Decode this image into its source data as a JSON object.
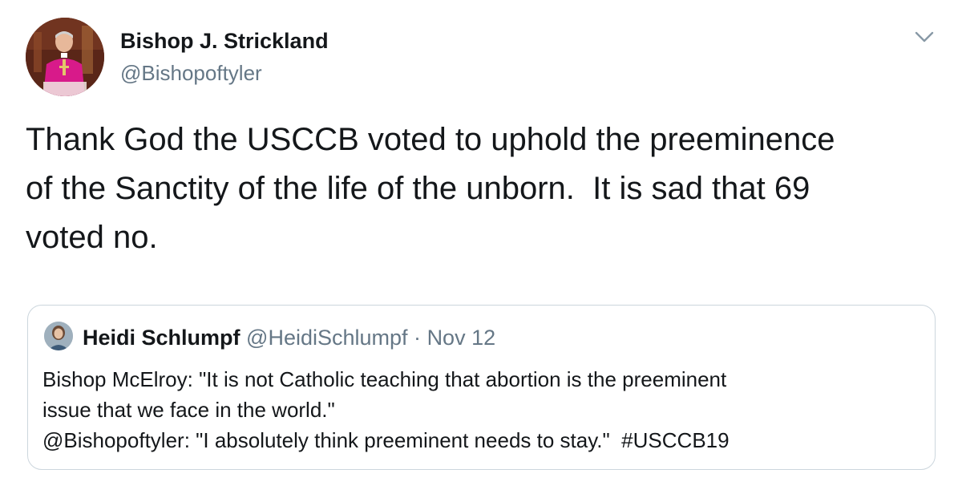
{
  "tweet": {
    "author": {
      "name": "Bishop J. Strickland",
      "handle": "@Bishopoftyler",
      "avatar_icon": "profile-photo"
    },
    "menu_icon": "chevron-down-icon",
    "text": "Thank God the USCCB voted to uphold the preeminence\nof the Sanctity of the life of the unborn.  It is sad that 69\nvoted no."
  },
  "quoted_tweet": {
    "author": {
      "name": "Heidi Schlumpf",
      "handle": "@HeidiSchlumpf",
      "avatar_icon": "profile-photo"
    },
    "separator": "·",
    "date": "Nov 12",
    "lines": [
      "Bishop McElroy: \"It is not Catholic teaching that abortion is the preeminent",
      "issue that we face in the world.\"",
      "@Bishopoftyler: \"I absolutely think preeminent needs to stay.\"  #USCCB19"
    ]
  },
  "colors": {
    "text_primary": "#14171a",
    "text_secondary": "#657786",
    "border": "#ccd6dd"
  }
}
